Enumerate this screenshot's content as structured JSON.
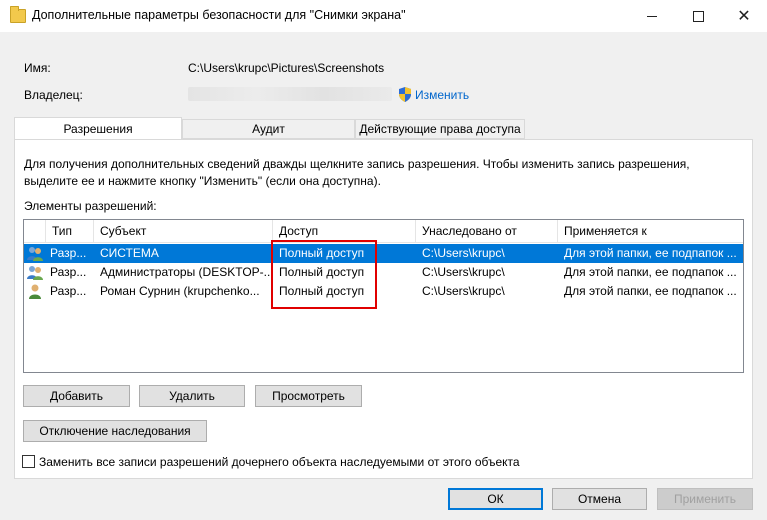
{
  "window": {
    "title": "Дополнительные параметры безопасности  для \"Снимки экрана\"",
    "minimize": "",
    "maximize": "",
    "close": "✕"
  },
  "props": {
    "name_label": "Имя:",
    "name_value": "C:\\Users\\krupc\\Pictures\\Screenshots",
    "owner_label": "Владелец:",
    "change_link": "Изменить"
  },
  "tabs": [
    {
      "label": "Разрешения",
      "active": true
    },
    {
      "label": "Аудит",
      "active": false
    },
    {
      "label": "Действующие права доступа",
      "active": false
    }
  ],
  "info_text": "Для получения дополнительных сведений дважды щелкните запись разрешения. Чтобы изменить запись разрешения, выделите ее и нажмите кнопку \"Изменить\" (если она доступна).",
  "permissions": {
    "group_label": "Элементы разрешений:",
    "columns": [
      "Тип",
      "Субъект",
      "Доступ",
      "Унаследовано от",
      "Применяется к"
    ],
    "rows": [
      {
        "type": "Разр...",
        "subject": "СИСТЕМА",
        "access": "Полный доступ",
        "inherited": "C:\\Users\\krupc\\",
        "applies": "Для этой папки, ее подпапок ...",
        "selected": true,
        "icon": "group-users-icon"
      },
      {
        "type": "Разр...",
        "subject": "Администраторы (DESKTOP-...",
        "access": "Полный доступ",
        "inherited": "C:\\Users\\krupc\\",
        "applies": "Для этой папки, ее подпапок ...",
        "selected": false,
        "icon": "group-users-icon"
      },
      {
        "type": "Разр...",
        "subject": "Роман Сурнин (krupchenko...",
        "access": "Полный доступ",
        "inherited": "C:\\Users\\krupc\\",
        "applies": "Для этой папки, ее подпапок ...",
        "selected": false,
        "icon": "user-icon"
      }
    ]
  },
  "buttons": {
    "add": "Добавить",
    "remove": "Удалить",
    "view": "Просмотреть",
    "disable_inheritance": "Отключение наследования",
    "ok": "ОК",
    "cancel": "Отмена",
    "apply": "Применить"
  },
  "replace_checkbox_label": "Заменить все записи разрешений дочернего объекта наследуемыми от этого объекта",
  "colors": {
    "selection": "#0078d7",
    "highlight_box": "#e00000",
    "link": "#0066cc"
  }
}
